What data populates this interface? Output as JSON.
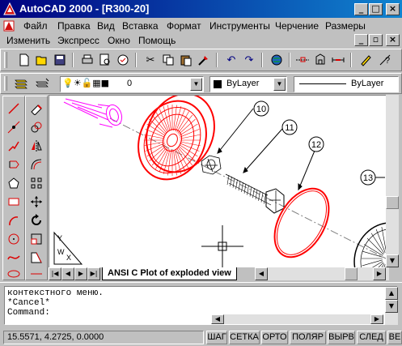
{
  "window": {
    "title": "AutoCAD 2000 - [R300-20]"
  },
  "menubar": {
    "items": [
      {
        "label": "Файл"
      },
      {
        "label": "Правка"
      },
      {
        "label": "Вид"
      },
      {
        "label": "Вставка"
      },
      {
        "label": "Формат"
      },
      {
        "label": "Инструменты"
      },
      {
        "label": "Черчение"
      },
      {
        "label": "Размеры"
      }
    ],
    "items2": [
      {
        "label": "Изменить"
      },
      {
        "label": "Экспресс"
      },
      {
        "label": "Окно"
      },
      {
        "label": "Помощь"
      }
    ]
  },
  "properties": {
    "layer": "0",
    "color": "ByLayer",
    "linetype": "ByLayer"
  },
  "drawing": {
    "callouts": [
      "10",
      "11",
      "12",
      "13"
    ],
    "ucs_labels": {
      "y": "Y",
      "w": "W",
      "x": "X"
    }
  },
  "tabs": {
    "active": "ANSI C Plot of exploded view"
  },
  "command": {
    "lines": [
      "контекстного меню.",
      "*Cancel*"
    ],
    "prompt": "Command:"
  },
  "status": {
    "coords": "15.5571, 4.2725, 0.0000",
    "modes": [
      "ШАГ",
      "СЕТКА",
      "ОРТО",
      "ПОЛЯР",
      "ВЫРВ",
      "СЛЕД",
      "ВЕ"
    ]
  },
  "colors": {
    "title_start": "#000080",
    "title_end": "#1084d0",
    "wheel": "#ff0000",
    "shaft": "#ff00ff"
  }
}
